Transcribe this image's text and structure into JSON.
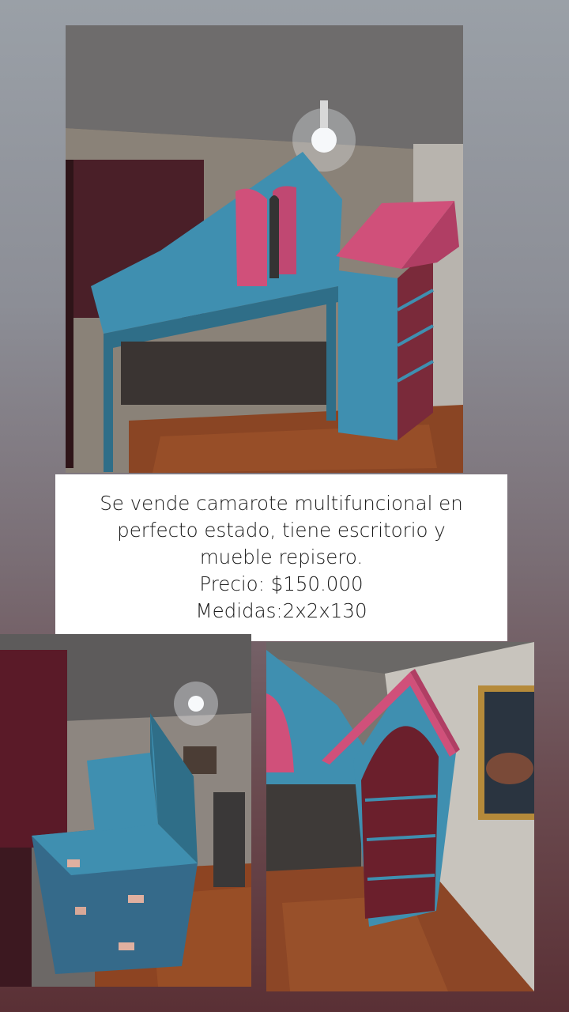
{
  "post": {
    "description_lines": [
      "Se vende camarote multifuncional en",
      "perfecto estado, tiene escritorio y",
      "mueble repisero."
    ],
    "price": "Precio: $150.000",
    "measurements": "Medidas:2x2x130"
  },
  "colors": {
    "background_top": "#9aa0a7",
    "background_bottom": "#5a3035",
    "card": "#ffffff",
    "furniture_blue": "#3f8fb0",
    "furniture_pink": "#d0507a"
  }
}
